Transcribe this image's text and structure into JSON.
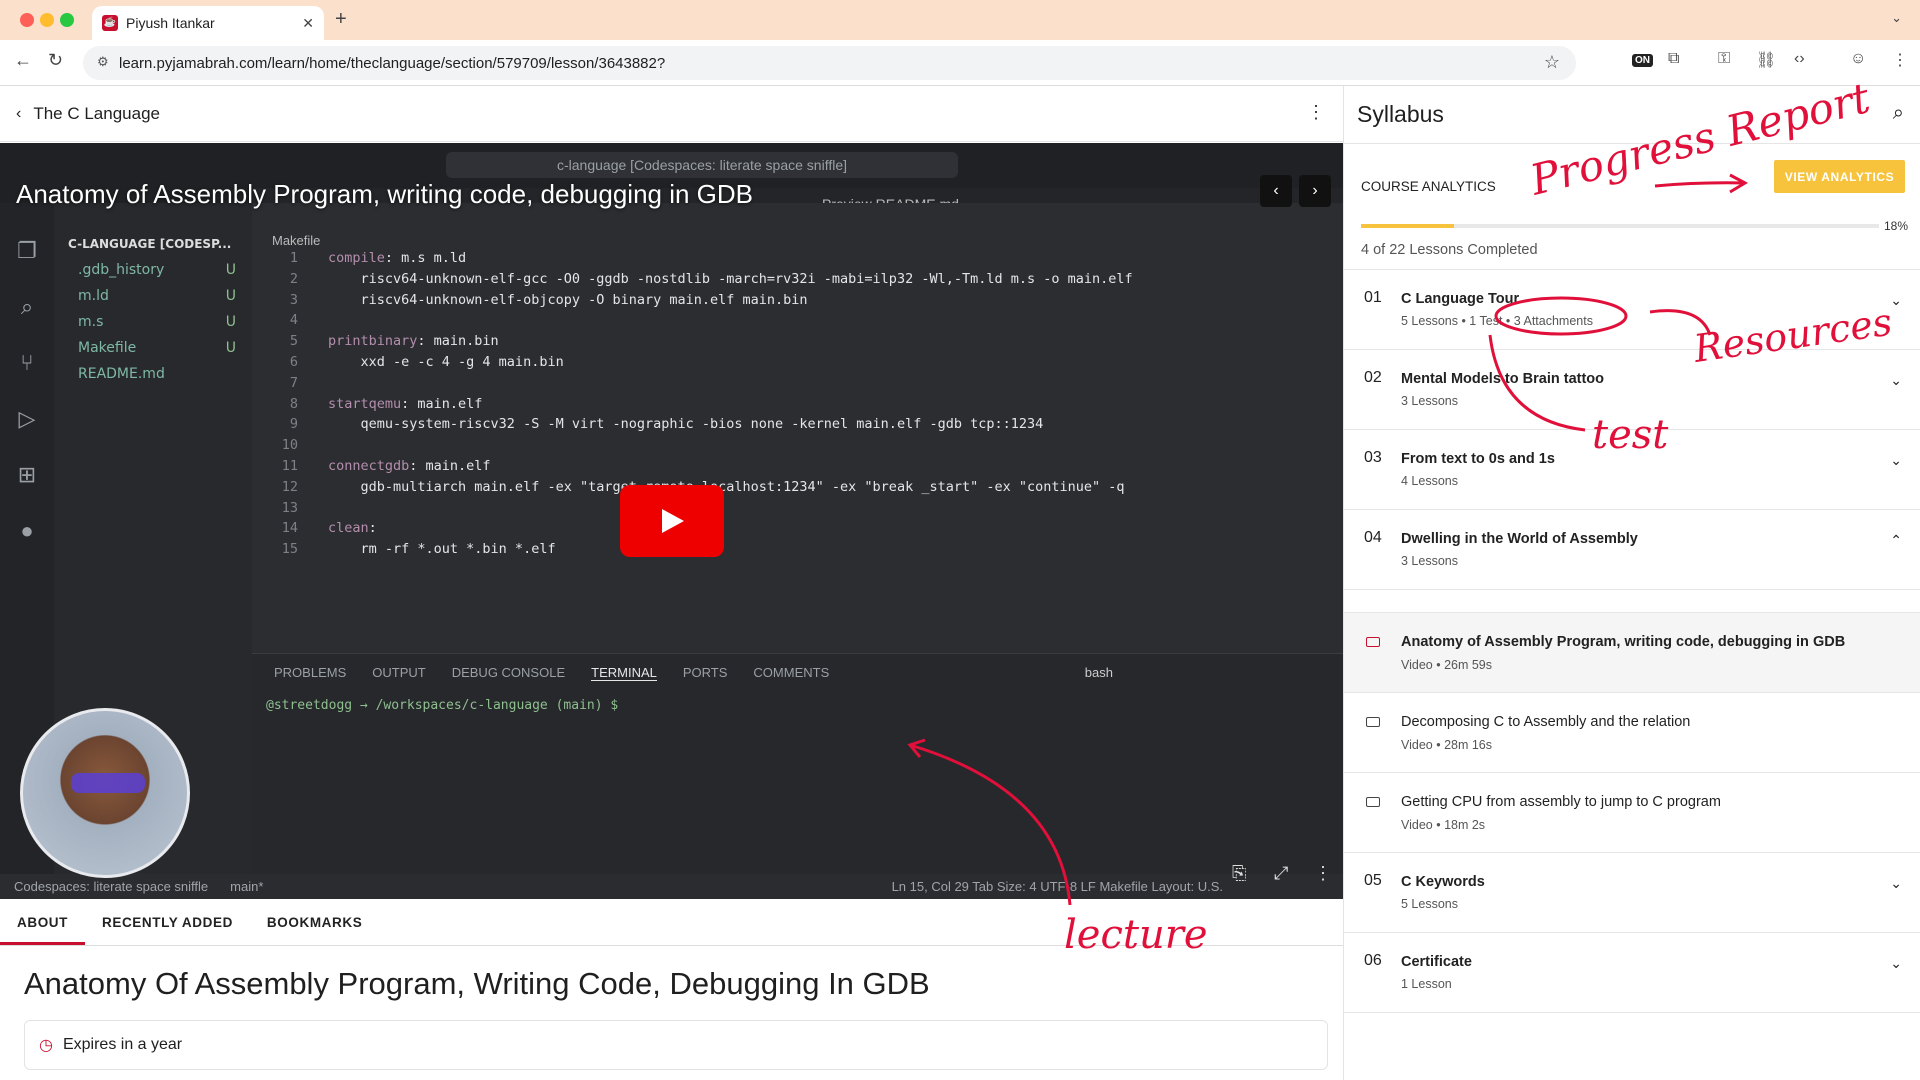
{
  "browser": {
    "tab_title": "Piyush Itankar",
    "url": "learn.pyjamabrah.com/learn/home/theclanguage/section/579709/lesson/3643882?",
    "ext_badge": "ON"
  },
  "course": {
    "back_label": "The C Language"
  },
  "video": {
    "title": "Anatomy of Assembly Program, writing code, debugging in GDB",
    "vscode_search": "c-language [Codespaces: literate space sniffle]",
    "explorer_header": "C-LANGUAGE [CODESP...",
    "explorer_files": [
      {
        "name": ".gdb_history",
        "badge": "U"
      },
      {
        "name": "m.ld",
        "badge": "U"
      },
      {
        "name": "m.s",
        "badge": "U"
      },
      {
        "name": "Makefile",
        "badge": "U"
      },
      {
        "name": "README.md",
        "badge": ""
      }
    ],
    "editor_file": "Makefile",
    "editor_tab_preview": "Preview README.md",
    "code_lines": [
      {
        "n": "1",
        "label": "compile",
        "text": ": m.s m.ld"
      },
      {
        "n": "2",
        "label": "",
        "text": "    riscv64-unknown-elf-gcc -O0 -ggdb -nostdlib -march=rv32i -mabi=ilp32 -Wl,-Tm.ld m.s -o main.elf"
      },
      {
        "n": "3",
        "label": "",
        "text": "    riscv64-unknown-elf-objcopy -O binary main.elf main.bin"
      },
      {
        "n": "4",
        "label": "",
        "text": ""
      },
      {
        "n": "5",
        "label": "printbinary",
        "text": ": main.bin"
      },
      {
        "n": "6",
        "label": "",
        "text": "    xxd -e -c 4 -g 4 main.bin"
      },
      {
        "n": "7",
        "label": "",
        "text": ""
      },
      {
        "n": "8",
        "label": "startqemu",
        "text": ": main.elf"
      },
      {
        "n": "9",
        "label": "",
        "text": "    qemu-system-riscv32 -S -M virt -nographic -bios none -kernel main.elf -gdb tcp::1234"
      },
      {
        "n": "10",
        "label": "",
        "text": ""
      },
      {
        "n": "11",
        "label": "connectgdb",
        "text": ": main.elf"
      },
      {
        "n": "12",
        "label": "",
        "text": "    gdb-multiarch main.elf -ex \"target remote localhost:1234\" -ex \"break _start\" -ex \"continue\" -q"
      },
      {
        "n": "13",
        "label": "",
        "text": ""
      },
      {
        "n": "14",
        "label": "clean",
        "text": ":"
      },
      {
        "n": "15",
        "label": "",
        "text": "    rm -rf *.out *.bin *.elf"
      }
    ],
    "panel_tabs": [
      "PROBLEMS",
      "OUTPUT",
      "DEBUG CONSOLE",
      "TERMINAL",
      "PORTS",
      "COMMENTS"
    ],
    "terminal_shell": "bash",
    "terminal_prompt": "@streetdogg → /workspaces/c-language (main) $",
    "status_left": "Codespaces: literate space sniffle",
    "status_branch": "main*",
    "status_right": "Ln 15, Col 29   Tab Size: 4   UTF-8   LF   Makefile   Layout: U.S."
  },
  "about": {
    "tabs": [
      "ABOUT",
      "RECENTLY ADDED",
      "BOOKMARKS"
    ],
    "lesson_heading": "Anatomy Of Assembly Program, Writing Code, Debugging In GDB",
    "expires": "Expires in a year"
  },
  "syllabus": {
    "title": "Syllabus",
    "analytics_label": "COURSE ANALYTICS",
    "analytics_button": "VIEW ANALYTICS",
    "progress_pct": "18%",
    "progress_value": 18,
    "completed_text": "4 of 22 Lessons Completed",
    "sections_before": [
      {
        "num": "01",
        "title": "C Language Tour",
        "meta": "5 Lessons • 1 Test • 3 Attachments",
        "chev": "⌄"
      },
      {
        "num": "02",
        "title": "Mental Models to Brain tattoo",
        "meta": "3 Lessons",
        "chev": "⌄"
      },
      {
        "num": "03",
        "title": "From text to 0s and 1s",
        "meta": "4 Lessons",
        "chev": "⌄"
      },
      {
        "num": "04",
        "title": "Dwelling in the World of Assembly",
        "meta": "3 Lessons",
        "chev": "⌃"
      }
    ],
    "lessons": [
      {
        "title": "Anatomy of Assembly Program, writing code, debugging in GDB",
        "meta": "Video • 26m 59s"
      },
      {
        "title": "Decomposing C to Assembly and the relation",
        "meta": "Video • 28m 16s"
      },
      {
        "title": "Getting CPU from assembly to jump to C program",
        "meta": "Video • 18m 2s"
      }
    ],
    "sections_after": [
      {
        "num": "05",
        "title": "C Keywords",
        "meta": "5 Lessons",
        "chev": "⌄"
      },
      {
        "num": "06",
        "title": "Certificate",
        "meta": "1 Lesson",
        "chev": "⌄"
      }
    ]
  },
  "annotations": {
    "progress": "Progress Report",
    "resources": "Resources",
    "test": "test",
    "lecture": "lecture"
  },
  "colors": {
    "accent": "#c8102e",
    "analytics": "#f7c33c",
    "annotation": "#e0103a"
  }
}
